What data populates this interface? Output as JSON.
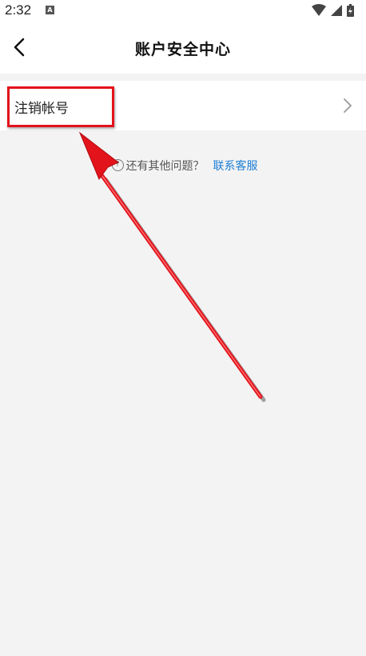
{
  "status_bar": {
    "time": "2:32",
    "app_icon_letter": "A",
    "icons": [
      "wifi-icon",
      "signal-icon",
      "battery-icon"
    ]
  },
  "header": {
    "back_icon": "chevron-left-icon",
    "title": "账户安全中心"
  },
  "menu": {
    "items": [
      {
        "label": "注销帐号",
        "icon": "chevron-right-icon"
      }
    ]
  },
  "help": {
    "icon": "question-circle-icon",
    "question": "还有其他问题？",
    "link": "联系客服"
  },
  "annotation": {
    "highlight_color": "#e3131b"
  },
  "colors": {
    "link": "#1d7fd6",
    "background": "#f3f3f3",
    "card": "#ffffff",
    "annotation": "#e3131b"
  }
}
